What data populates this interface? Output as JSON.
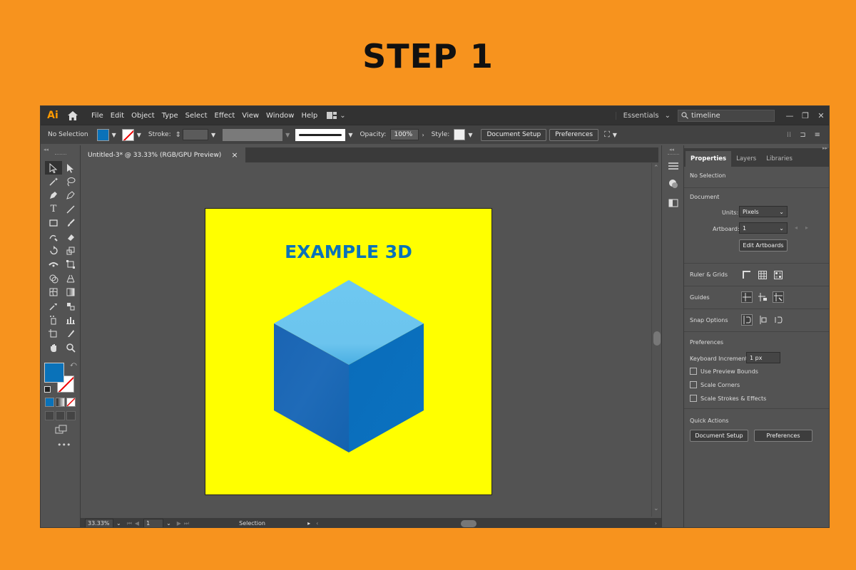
{
  "heading": "STEP 1",
  "app": {
    "logo": "Ai",
    "menu": [
      "File",
      "Edit",
      "Object",
      "Type",
      "Select",
      "Effect",
      "View",
      "Window",
      "Help"
    ],
    "workspace": "Essentials",
    "search_value": "timeline"
  },
  "control_bar": {
    "selection": "No Selection",
    "stroke_label": "Stroke:",
    "opacity_label": "Opacity:",
    "opacity_value": "100%",
    "style_label": "Style:",
    "document_setup": "Document Setup",
    "preferences": "Preferences",
    "fill_color": "#0A72B9"
  },
  "document_tab": {
    "title": "Untitled-3* @ 33.33% (RGB/GPU Preview)",
    "close": "×"
  },
  "artboard": {
    "title": "EXAMPLE 3D",
    "background": "#FFFF00",
    "title_color": "#0A72B9"
  },
  "status_bar": {
    "zoom": "33.33%",
    "artboard_number": "1",
    "tool": "Selection"
  },
  "properties": {
    "tabs": [
      "Properties",
      "Layers",
      "Libraries"
    ],
    "no_selection": "No Selection",
    "document_heading": "Document",
    "units_label": "Units:",
    "units_value": "Pixels",
    "artboard_label": "Artboard:",
    "artboard_value": "1",
    "edit_artboards": "Edit Artboards",
    "rulers_grids": "Ruler & Grids",
    "guides": "Guides",
    "snap_options": "Snap Options",
    "preferences_heading": "Preferences",
    "keyboard_increment_label": "Keyboard Increment:",
    "keyboard_increment_value": "1 px",
    "use_preview_bounds": "Use Preview Bounds",
    "scale_corners": "Scale Corners",
    "scale_strokes": "Scale Strokes & Effects",
    "quick_actions": "Quick Actions",
    "qa_document_setup": "Document Setup",
    "qa_preferences": "Preferences"
  }
}
